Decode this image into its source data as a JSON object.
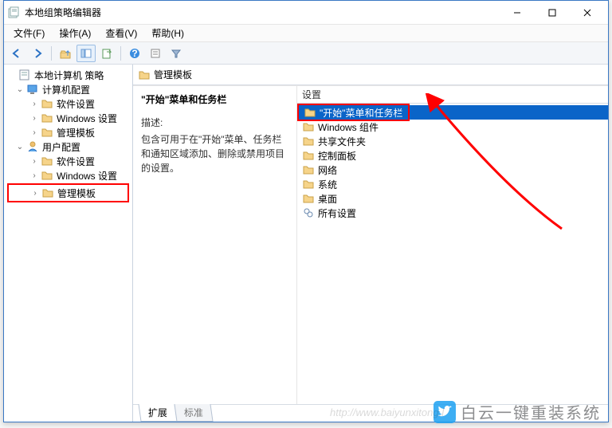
{
  "window": {
    "title": "本地组策略编辑器"
  },
  "menubar": {
    "file": "文件(F)",
    "action": "操作(A)",
    "view": "查看(V)",
    "help": "帮助(H)"
  },
  "tree": {
    "root": "本地计算机 策略",
    "computer_config": "计算机配置",
    "cc_software": "软件设置",
    "cc_windows": "Windows 设置",
    "cc_admin": "管理模板",
    "user_config": "用户配置",
    "uc_software": "软件设置",
    "uc_windows": "Windows 设置",
    "uc_admin": "管理模板"
  },
  "content": {
    "breadcrumb": "管理模板",
    "title": "\"开始\"菜单和任务栏",
    "desc_label": "描述:",
    "desc_text": "包含可用于在\"开始\"菜单、任务栏和通知区域添加、删除或禁用项目的设置。",
    "list_header": "设置",
    "items": [
      "\"开始\"菜单和任务栏",
      "Windows 组件",
      "共享文件夹",
      "控制面板",
      "网络",
      "系统",
      "桌面",
      "所有设置"
    ]
  },
  "tabs": {
    "extended": "扩展",
    "standard": "标准"
  },
  "watermark": {
    "brand": "白云一键重装系统",
    "url": "http://www.baiyunxitong.l"
  }
}
